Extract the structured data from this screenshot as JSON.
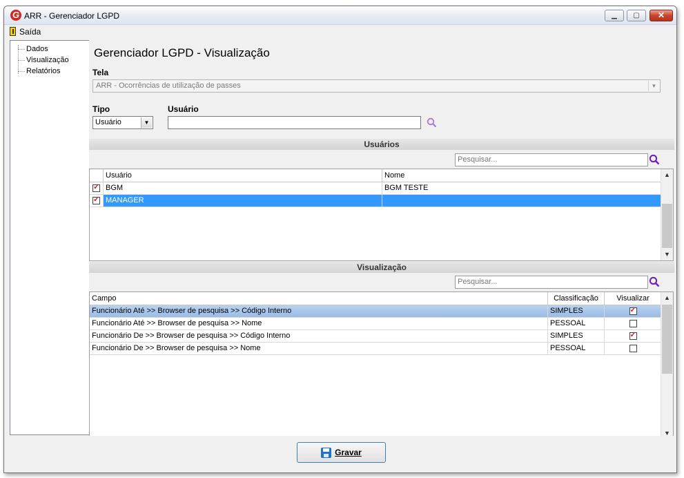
{
  "window": {
    "title": "ARR - Gerenciador LGPD",
    "logo_letter": "G",
    "min_label": "▁",
    "max_label": "▢",
    "close_label": "✕"
  },
  "menu": {
    "exit_label": "Saída"
  },
  "tree": {
    "items": [
      "Dados",
      "Visualização",
      "Relatórios"
    ]
  },
  "main": {
    "heading": "Gerenciador LGPD - Visualização",
    "tela_label": "Tela",
    "tela_value": "ARR - Ocorrências de utilização de passes",
    "tipo_label": "Tipo",
    "tipo_value": "Usuário",
    "usuario_label": "Usuário",
    "usuario_value": ""
  },
  "users_section": {
    "title": "Usuários",
    "search_placeholder": "Pesquisar...",
    "columns": [
      "",
      "Usuário",
      "Nome"
    ],
    "rows": [
      {
        "checked": true,
        "usuario": "BGM",
        "nome": "BGM TESTE"
      },
      {
        "checked": true,
        "usuario": "MANAGER",
        "nome": ""
      }
    ]
  },
  "view_section": {
    "title": "Visualização",
    "search_placeholder": "Pesquisar...",
    "columns": [
      "Campo",
      "Classificação",
      "Visualizar"
    ],
    "rows": [
      {
        "campo": "Funcionário Até >> Browser de pesquisa >> Código Interno",
        "classificacao": "SIMPLES",
        "visualizar": true
      },
      {
        "campo": "Funcionário Até >> Browser de pesquisa >> Nome",
        "classificacao": "PESSOAL",
        "visualizar": false
      },
      {
        "campo": "Funcionário De >> Browser de pesquisa >> Código Interno",
        "classificacao": "SIMPLES",
        "visualizar": true
      },
      {
        "campo": "Funcionário De >> Browser de pesquisa >> Nome",
        "classificacao": "PESSOAL",
        "visualizar": false
      }
    ]
  },
  "footer": {
    "save_label": "Gravar"
  },
  "colors": {
    "selection": "#3399ff",
    "highlight_row": "#9bbce6",
    "accent_search_icon": "#7b2fbf",
    "check_red": "#d0202b"
  }
}
